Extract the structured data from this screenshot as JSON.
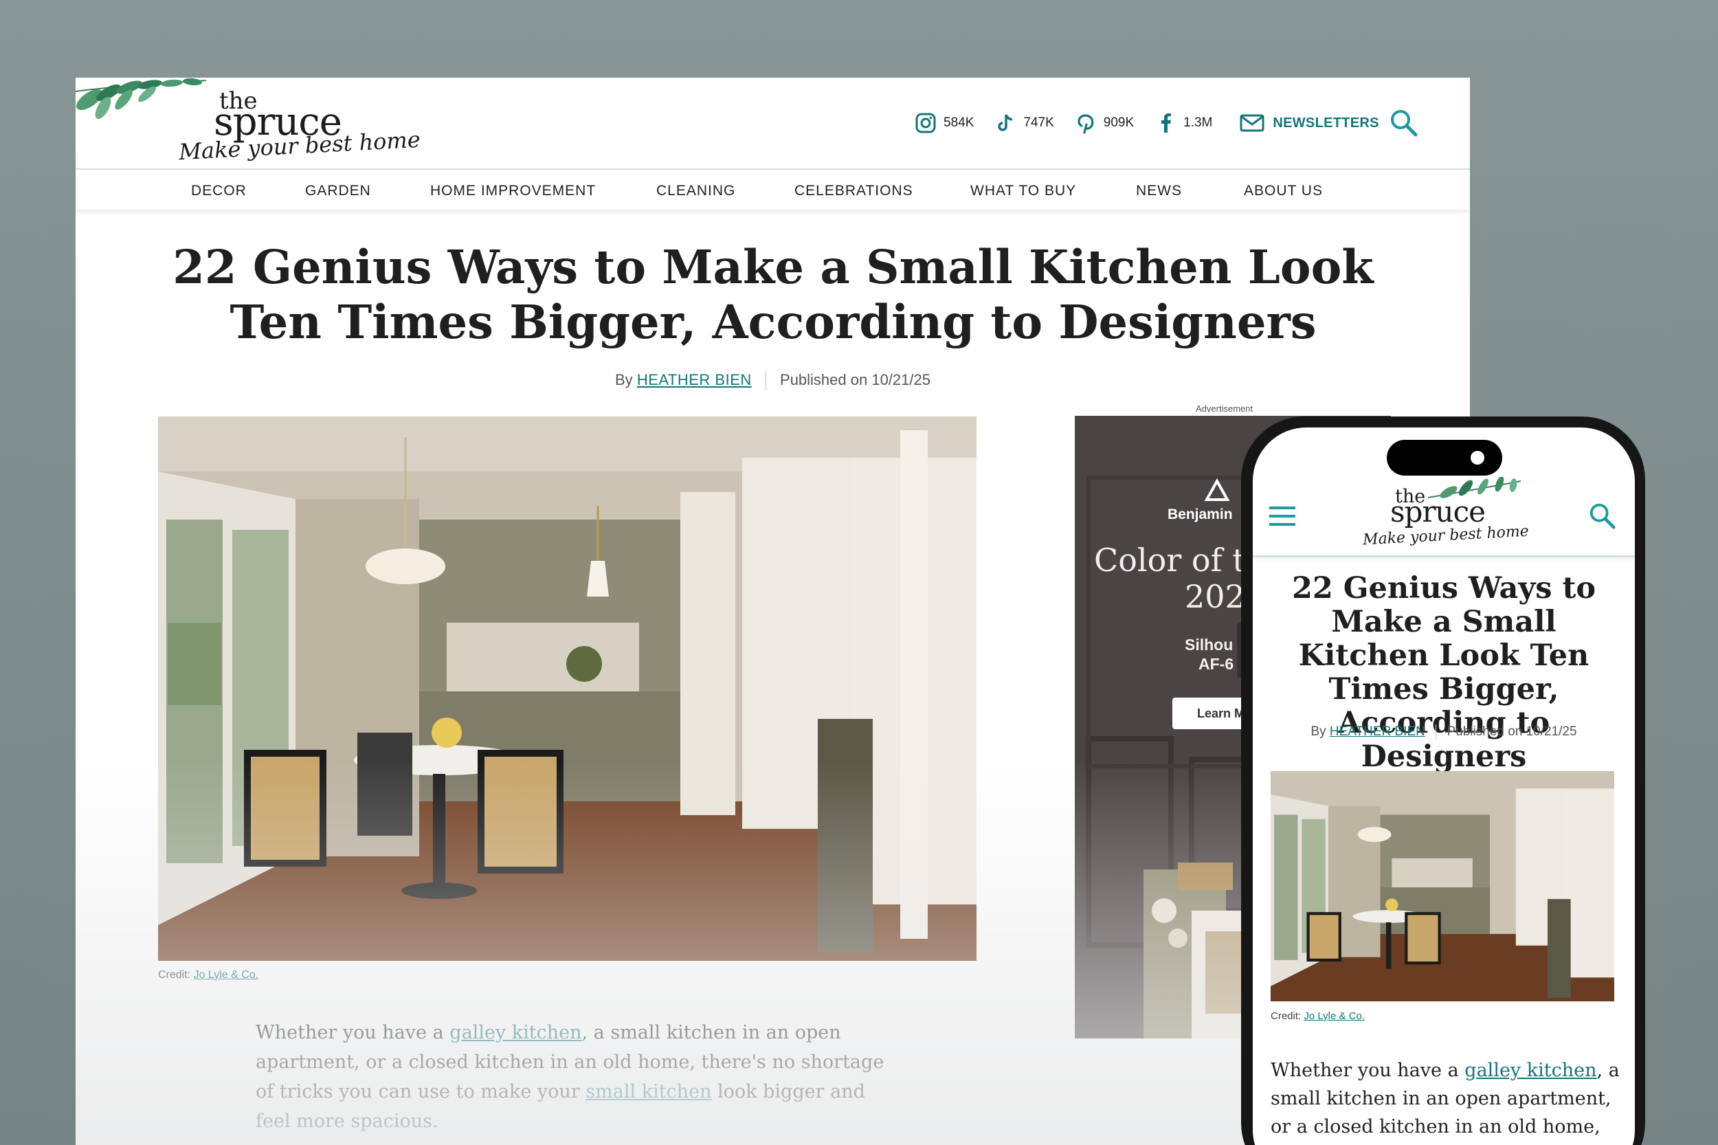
{
  "brand": {
    "the": "the",
    "spruce": "spruce",
    "tagline": "Make your best home"
  },
  "socials": [
    {
      "icon": "instagram-icon",
      "count": "584K"
    },
    {
      "icon": "tiktok-icon",
      "count": "747K"
    },
    {
      "icon": "pinterest-icon",
      "count": "909K"
    },
    {
      "icon": "facebook-icon",
      "count": "1.3M"
    }
  ],
  "newsletter_label": "NEWSLETTERS",
  "nav": [
    "DECOR",
    "GARDEN",
    "HOME IMPROVEMENT",
    "CLEANING",
    "CELEBRATIONS",
    "WHAT TO BUY",
    "NEWS",
    "ABOUT US"
  ],
  "article": {
    "title": "22 Genius Ways to Make a Small Kitchen Look Ten Times Bigger, According to Designers",
    "by": "By",
    "author": "HEATHER BIEN",
    "published": "Published on 10/21/25",
    "credit_label": "Credit:",
    "credit_name": "Jo Lyle & Co.",
    "intro_1": "Whether you have a ",
    "link_1": "galley kitchen",
    "intro_2": ", a small kitchen in an open apartment, or a closed kitchen in an old home, there's no shortage of tricks you can use to make your ",
    "link_2": "small kitchen",
    "intro_3": " look bigger and feel more spacious.",
    "mobile_intro_2": ", a small kitchen in an open apartment, or a closed kitchen in an old home, there's"
  },
  "ad": {
    "label": "Advertisement",
    "brand": "Benjamin",
    "line1": "Color of t",
    "line2": "202",
    "line3": "Silhou",
    "line4": "AF-6",
    "button": "Learn M"
  },
  "colors": {
    "accent": "#13757a",
    "background": "#829191"
  }
}
